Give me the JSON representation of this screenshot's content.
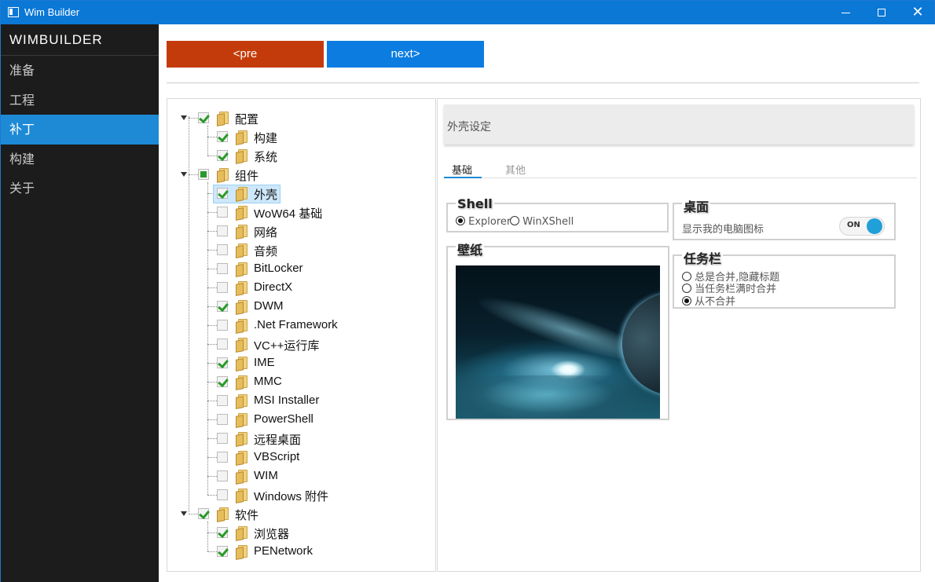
{
  "window": {
    "title": "Wim Builder"
  },
  "sidebar": {
    "brand": "WIMBUILDER",
    "items": [
      {
        "label": "准备"
      },
      {
        "label": "工程"
      },
      {
        "label": "补丁",
        "active": true
      },
      {
        "label": "构建"
      },
      {
        "label": "关于"
      }
    ]
  },
  "toolbar": {
    "pre_label": "<pre",
    "next_label": "next>"
  },
  "tree": {
    "items": [
      {
        "label": "配置",
        "state": "checked"
      },
      {
        "label": "构建",
        "state": "checked"
      },
      {
        "label": "系统",
        "state": "checked"
      },
      {
        "label": "组件",
        "state": "partial"
      },
      {
        "label": "外壳",
        "state": "checked",
        "selected": true
      },
      {
        "label": "WoW64 基础",
        "state": "unchecked"
      },
      {
        "label": "网络",
        "state": "unchecked"
      },
      {
        "label": "音频",
        "state": "unchecked"
      },
      {
        "label": "BitLocker",
        "state": "unchecked"
      },
      {
        "label": "DirectX",
        "state": "unchecked"
      },
      {
        "label": "DWM",
        "state": "checked"
      },
      {
        "label": ".Net Framework",
        "state": "unchecked"
      },
      {
        "label": "VC++运行库",
        "state": "unchecked"
      },
      {
        "label": "IME",
        "state": "checked"
      },
      {
        "label": "MMC",
        "state": "checked"
      },
      {
        "label": "MSI Installer",
        "state": "unchecked"
      },
      {
        "label": "PowerShell",
        "state": "unchecked"
      },
      {
        "label": "远程桌面",
        "state": "unchecked"
      },
      {
        "label": "VBScript",
        "state": "unchecked"
      },
      {
        "label": "WIM",
        "state": "unchecked"
      },
      {
        "label": "Windows 附件",
        "state": "unchecked"
      },
      {
        "label": "软件",
        "state": "checked"
      },
      {
        "label": "浏览器",
        "state": "checked"
      },
      {
        "label": "PENetwork",
        "state": "checked"
      }
    ]
  },
  "content": {
    "header": "外壳设定",
    "tabs": [
      {
        "label": "基础",
        "active": true
      },
      {
        "label": "其他"
      }
    ],
    "shell": {
      "title": "Shell",
      "options": [
        {
          "label": "Explorer",
          "selected": true
        },
        {
          "label": "WinXShell",
          "selected": false
        }
      ]
    },
    "desktop": {
      "title": "桌面",
      "show_icon_label": "显示我的电脑图标",
      "toggle_label": "ON"
    },
    "wallpaper": {
      "title": "壁纸"
    },
    "taskbar": {
      "title": "任务栏",
      "options": [
        {
          "label": "总是合并,隐藏标题",
          "selected": false
        },
        {
          "label": "当任务栏满时合并",
          "selected": false
        },
        {
          "label": "从不合并",
          "selected": true
        }
      ]
    }
  },
  "colors": {
    "titlebar": "#0b78d6",
    "sidebar_bg": "#1c1c1c",
    "sidebar_active": "#1e8ad6",
    "pre_button": "#c43b0b",
    "next_button": "#0c7ce0",
    "checkbox_green": "#2a9a2a",
    "toggle_knob": "#21a0d8"
  }
}
